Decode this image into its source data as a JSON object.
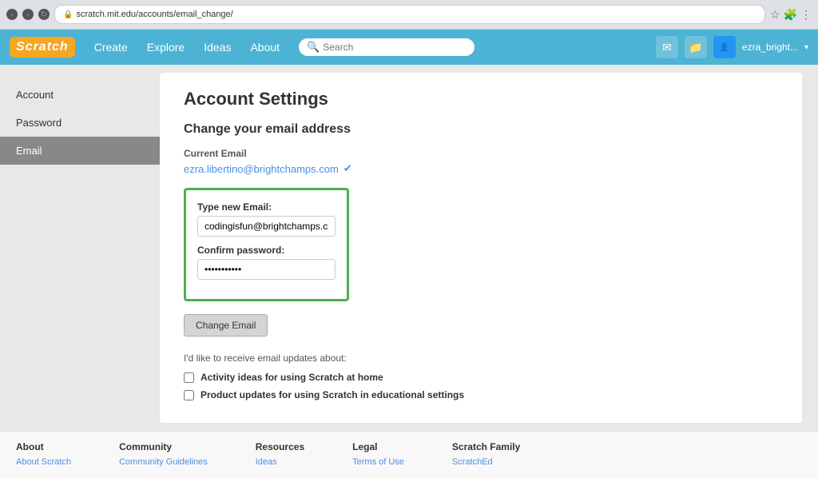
{
  "browser": {
    "url": "scratch.mit.edu/accounts/email_change/",
    "search_placeholder": "Search"
  },
  "navbar": {
    "logo": "Scratch",
    "links": [
      "Create",
      "Explore",
      "Ideas",
      "About"
    ],
    "search_placeholder": "Search",
    "username": "ezra_bright..."
  },
  "sidebar": {
    "items": [
      {
        "label": "Account",
        "active": false
      },
      {
        "label": "Password",
        "active": false
      },
      {
        "label": "Email",
        "active": true
      }
    ]
  },
  "content": {
    "page_title": "Account Settings",
    "section_title": "Change your email address",
    "current_email_label": "Current Email",
    "current_email": "ezra.libertino@brightchamps.com",
    "new_email_label": "Type new Email:",
    "new_email_value": "codingisfun@brightchamps.com",
    "confirm_password_label": "Confirm password:",
    "confirm_password_value": "••••••••••••",
    "change_email_btn": "Change Email",
    "updates_text": "I'd like to receive email updates about:",
    "checkbox1": "Activity ideas for using Scratch at home",
    "checkbox2": "Product updates for using Scratch in educational settings"
  },
  "footer": {
    "columns": [
      {
        "title": "About",
        "links": [
          "About Scratch"
        ]
      },
      {
        "title": "Community",
        "links": [
          "Community Guidelines"
        ]
      },
      {
        "title": "Resources",
        "links": [
          "Ideas"
        ]
      },
      {
        "title": "Legal",
        "links": [
          "Terms of Use"
        ]
      },
      {
        "title": "Scratch Family",
        "links": [
          "ScratchEd"
        ]
      }
    ]
  }
}
